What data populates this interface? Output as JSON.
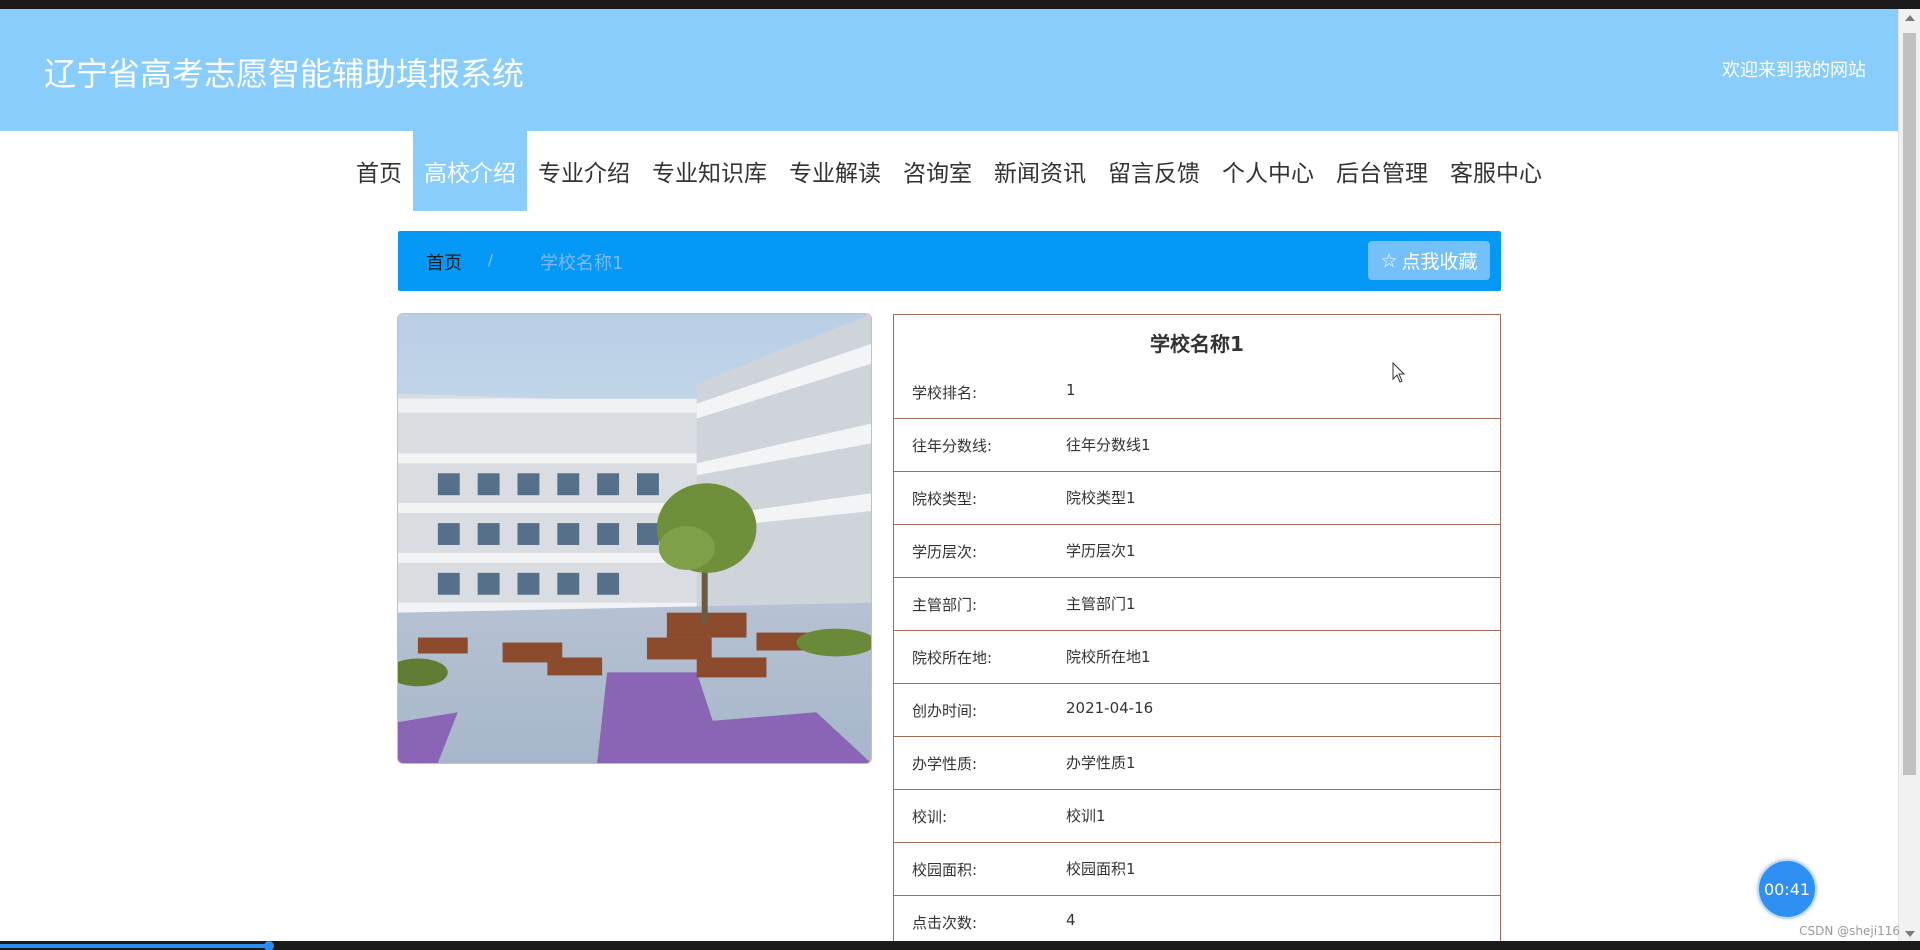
{
  "header": {
    "site_title": "辽宁省高考志愿智能辅助填报系统",
    "welcome": "欢迎来到我的网站"
  },
  "nav": {
    "items": [
      {
        "label": "首页",
        "active": false
      },
      {
        "label": "高校介绍",
        "active": true
      },
      {
        "label": "专业介绍",
        "active": false
      },
      {
        "label": "专业知识库",
        "active": false
      },
      {
        "label": "专业解读",
        "active": false
      },
      {
        "label": "咨询室",
        "active": false
      },
      {
        "label": "新闻资讯",
        "active": false
      },
      {
        "label": "留言反馈",
        "active": false
      },
      {
        "label": "个人中心",
        "active": false
      },
      {
        "label": "后台管理",
        "active": false
      },
      {
        "label": "客服中心",
        "active": false
      }
    ]
  },
  "breadcrumb": {
    "home": "首页",
    "separator": "/",
    "current": "学校名称1",
    "favorite_label": "点我收藏",
    "favorite_icon": "star-outline-icon"
  },
  "school": {
    "name": "学校名称1",
    "fields": [
      {
        "label": "学校排名:",
        "value": "1"
      },
      {
        "label": "往年分数线:",
        "value": "往年分数线1"
      },
      {
        "label": "院校类型:",
        "value": "院校类型1"
      },
      {
        "label": "学历层次:",
        "value": "学历层次1"
      },
      {
        "label": "主管部门:",
        "value": "主管部门1"
      },
      {
        "label": "院校所在地:",
        "value": "院校所在地1"
      },
      {
        "label": "创办时间:",
        "value": "2021-04-16"
      },
      {
        "label": "办学性质:",
        "value": "办学性质1"
      },
      {
        "label": "校训:",
        "value": "校训1"
      },
      {
        "label": "校园面积:",
        "value": "校园面积1"
      },
      {
        "label": "点击次数:",
        "value": "4"
      }
    ]
  },
  "overlay": {
    "timer": "00:41",
    "watermark": "CSDN @sheji116",
    "video_progress": 0.14
  },
  "colors": {
    "header_bg": "#88cdfb",
    "breadcrumb_bg": "#0599f7",
    "table_border": "#a56a5a"
  }
}
